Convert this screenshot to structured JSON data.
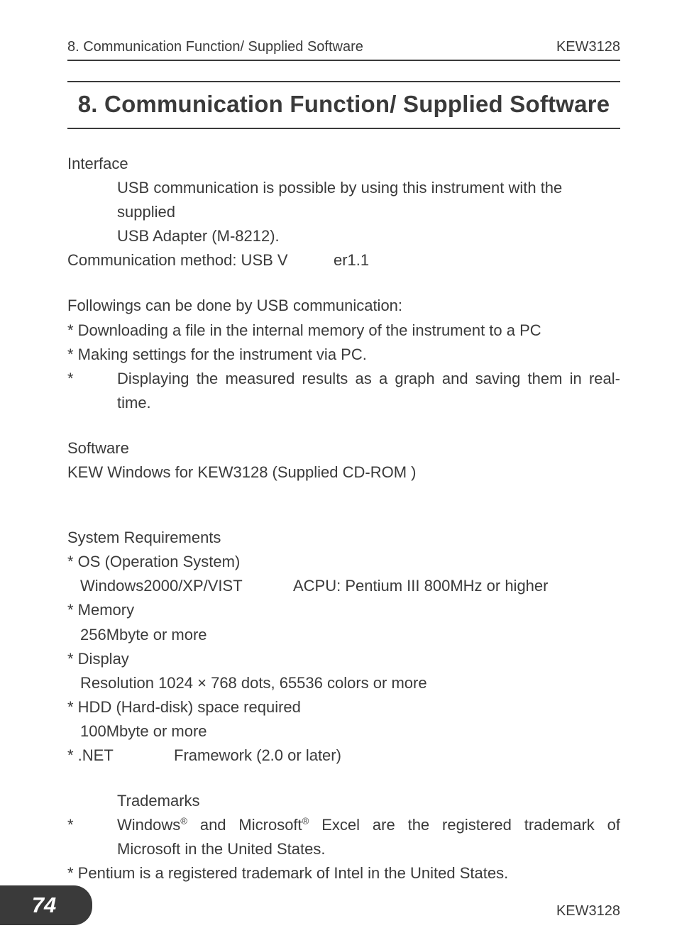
{
  "header": {
    "left": "8. Communication Function/ Supplied Software",
    "right": "KEW3128"
  },
  "chapter_title": "8. Communication Function/ Supplied Software",
  "interface": {
    "heading": "Interface",
    "line1": "USB communication is possible by using this instrument with the supplied",
    "line2": "USB Adapter (M-8212).",
    "comm_label": "Communication method: USB V",
    "comm_ver": "er1.1"
  },
  "followings": {
    "intro": "Followings can be done by USB communication:",
    "b1": "* Downloading a file in the internal memory of the instrument to a PC",
    "b2": "* Making settings for the instrument via PC.",
    "b3_ast": "*",
    "b3_txt": "Displaying the measured results as a graph and saving them in real-time."
  },
  "software": {
    "heading": "Software",
    "line": "KEW Windows for KEW3128 (Supplied CD-ROM )"
  },
  "sysreq": {
    "heading": "System Requirements",
    "os_label": "* OS (Operation System)",
    "os_left": "Windows2000/XP/VIST",
    "os_right": "ACPU: Pentium III 800MHz or higher",
    "mem_label": "* Memory",
    "mem_val": "256Mbyte or more",
    "disp_label": "* Display",
    "disp_val": "Resolution 1024 × 768 dots, 65536 colors or more",
    "hdd_label": "* HDD (Hard-disk) space required",
    "hdd_val": "100Mbyte or more",
    "net_left": "* .NET",
    "net_right": "Framework (2.0 or later)"
  },
  "trademarks": {
    "heading": "Trademarks",
    "t1_ast": "*",
    "t1_pre": "Windows",
    "t1_mid": " and Microsoft",
    "t1_post": " Excel are the registered trademark of Microsoft in the United States.",
    "reg": "®",
    "t2": "* Pentium is a registered trademark of Intel in the United States."
  },
  "footer": {
    "page": "74",
    "model": "KEW3128"
  }
}
